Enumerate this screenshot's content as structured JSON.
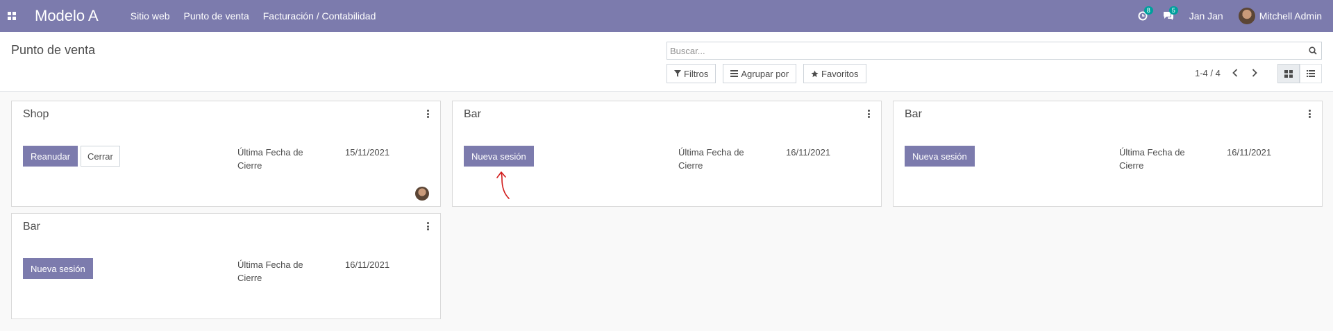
{
  "navbar": {
    "apps_icon": "apps-grid-icon",
    "brand": "Modelo A",
    "menu": [
      "Sitio web",
      "Punto de venta",
      "Facturación / Contabilidad"
    ],
    "activity_badge": "8",
    "messages_badge": "5",
    "company": "Jan Jan",
    "user": "Mitchell Admin",
    "color": "#7c7bad"
  },
  "control_panel": {
    "breadcrumb": "Punto de venta",
    "search_placeholder": "Buscar...",
    "filters_label": "Filtros",
    "group_by_label": "Agrupar por",
    "favorites_label": "Favoritos",
    "pager": "1-4 / 4"
  },
  "cards": [
    {
      "title": "Shop",
      "primary_button": "Reanudar",
      "secondary_button": "Cerrar",
      "label": "Última Fecha de Cierre",
      "value": "15/11/2021",
      "has_avatar": true
    },
    {
      "title": "Bar",
      "primary_button": "Nueva sesión",
      "label": "Última Fecha de Cierre",
      "value": "16/11/2021"
    },
    {
      "title": "Bar",
      "primary_button": "Nueva sesión",
      "label": "Última Fecha de Cierre",
      "value": "16/11/2021"
    },
    {
      "title": "Bar",
      "primary_button": "Nueva sesión",
      "label": "Última Fecha de Cierre",
      "value": "16/11/2021"
    }
  ],
  "colors": {
    "primary": "#7c7bad",
    "badge": "#00a09d",
    "annotation": "#d11a1a"
  }
}
